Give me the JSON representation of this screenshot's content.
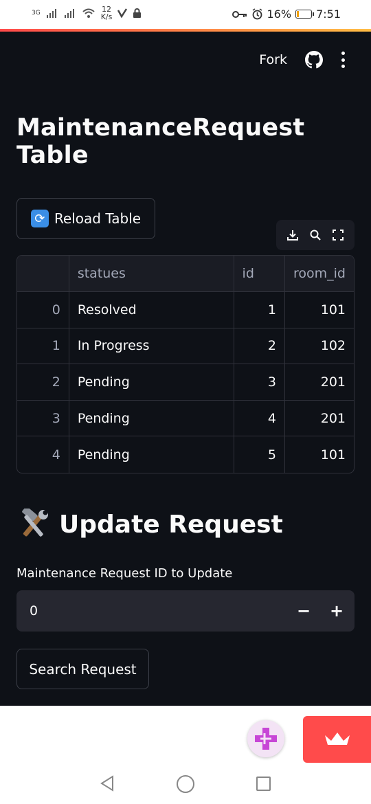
{
  "status_bar": {
    "network_label": "3G",
    "speed_value": "12",
    "speed_unit": "K/s",
    "battery": "16%",
    "battery_level": 0.16,
    "time": "7:51"
  },
  "toolbar": {
    "fork_label": "Fork"
  },
  "page": {
    "title": "MaintenanceRequest Table"
  },
  "reload_button": {
    "label": "Reload Table",
    "emoji": "🔄"
  },
  "table": {
    "columns": [
      "",
      "statues",
      "id",
      "room_id"
    ],
    "rows": [
      {
        "index": "0",
        "statues": "Resolved",
        "id": "1",
        "room_id": "101"
      },
      {
        "index": "1",
        "statues": "In Progress",
        "id": "2",
        "room_id": "102"
      },
      {
        "index": "2",
        "statues": "Pending",
        "id": "3",
        "room_id": "201"
      },
      {
        "index": "3",
        "statues": "Pending",
        "id": "4",
        "room_id": "201"
      },
      {
        "index": "4",
        "statues": "Pending",
        "id": "5",
        "room_id": "101"
      }
    ]
  },
  "update_section": {
    "title": "Update Request",
    "field_label": "Maintenance Request ID to Update",
    "field_value": "0",
    "minus_label": "−",
    "plus_label": "+",
    "search_button_label": "Search Request"
  },
  "colors": {
    "app_background": "#0e1117",
    "accent": "#ff4b4b",
    "input_background": "#262730"
  },
  "icons": [
    "wifi-icon",
    "key-icon",
    "alarm-icon",
    "github-icon",
    "more-icon",
    "download-icon",
    "search-icon",
    "fullscreen-icon",
    "hammer-wrench-icon",
    "crown-icon",
    "plus-badge-icon",
    "back-icon",
    "home-icon",
    "recents-icon"
  ]
}
